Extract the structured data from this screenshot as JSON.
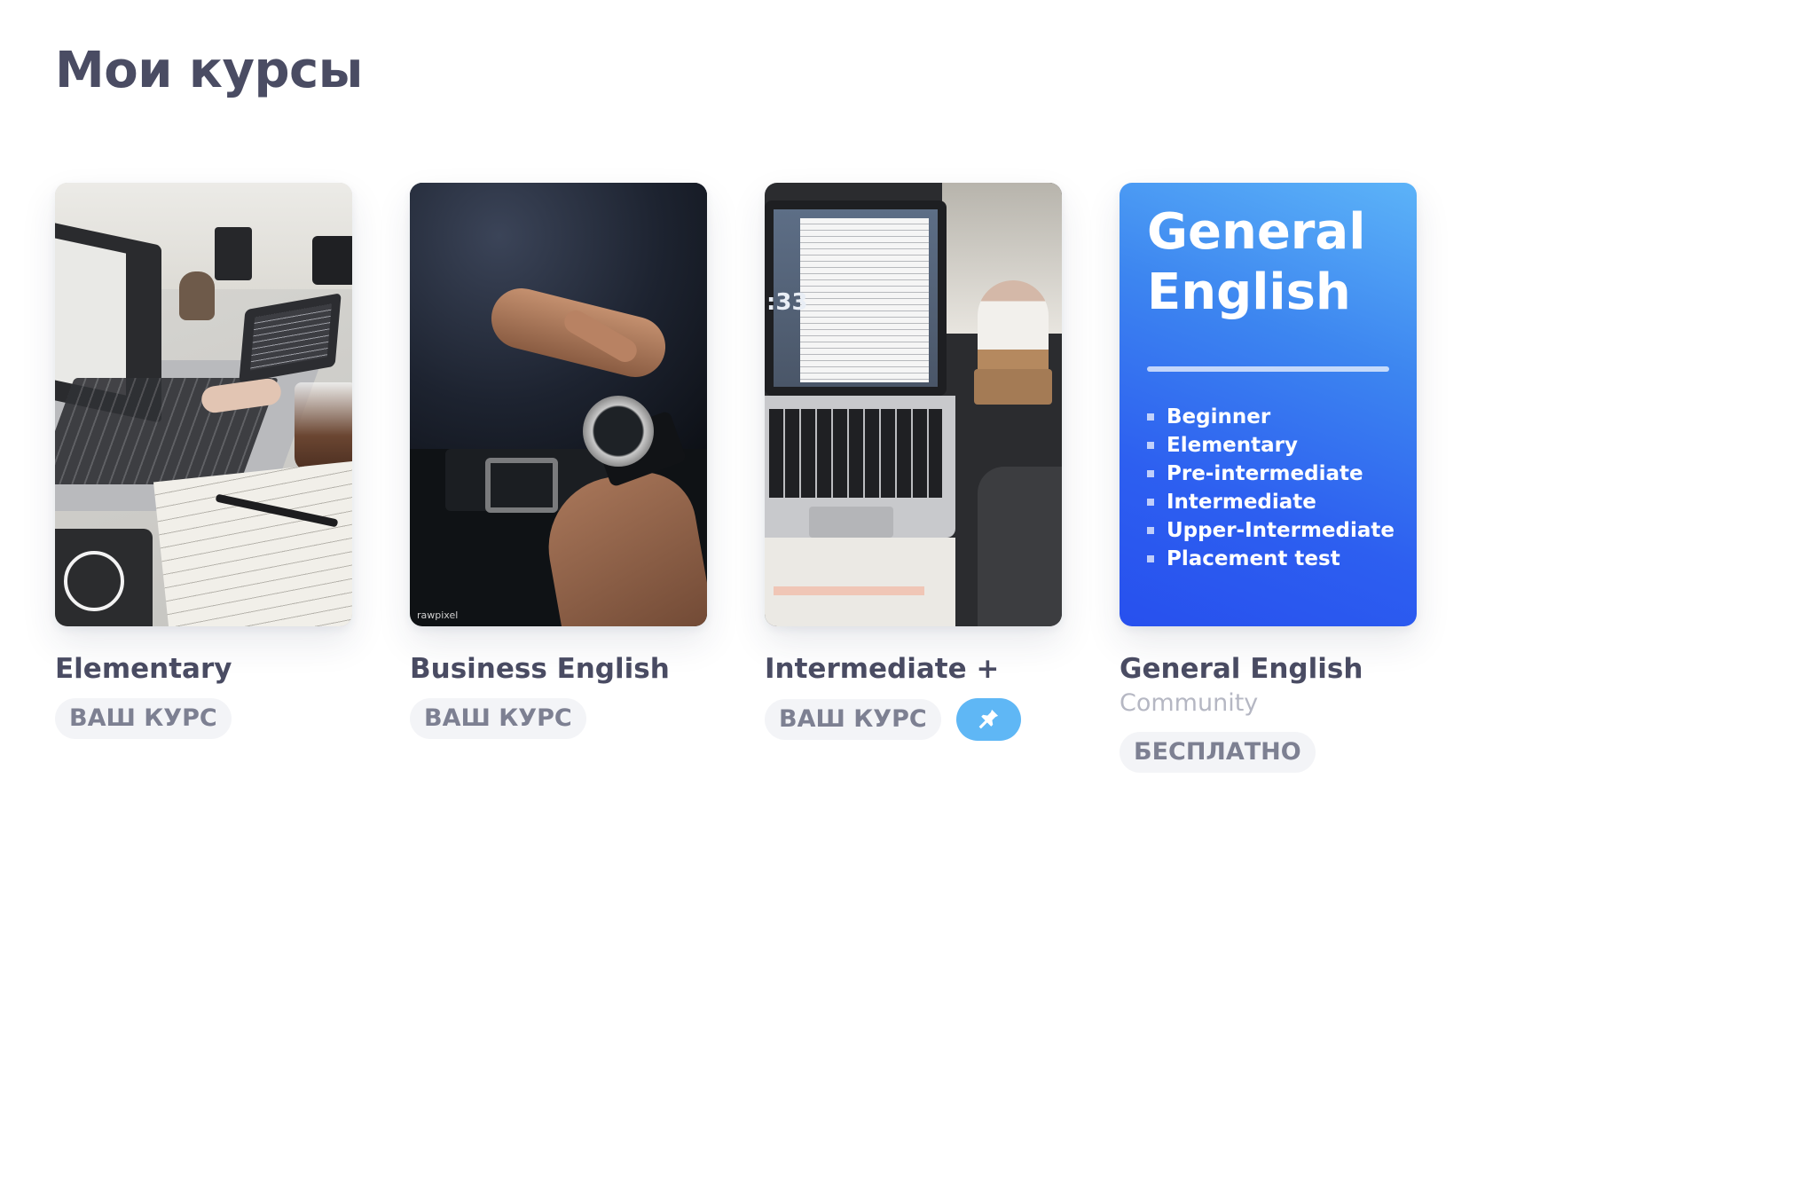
{
  "page": {
    "title": "Мои курсы"
  },
  "courses": [
    {
      "name": "Elementary",
      "badge": "ВАШ КУРС",
      "cover": "desk-laptop-photo"
    },
    {
      "name": "Business English",
      "badge": "ВАШ КУРС",
      "cover": "watch-photo",
      "watermark": "rawpixel"
    },
    {
      "name": "Intermediate +",
      "badge": "ВАШ КУРС",
      "cover": "laptop-coffee-photo",
      "pin_icon": "pin-icon",
      "pin_color": "#5fb7f5"
    },
    {
      "name": "General English",
      "subtitle": "Community",
      "badge": "БЕСПЛАТНО",
      "cover": {
        "title": "General English",
        "levels": [
          "Beginner",
          "Elementary",
          "Pre-intermediate",
          "Intermediate",
          "Upper-Intermediate",
          "Placement test"
        ],
        "gradient": [
          "#5cb3f8",
          "#2750ee"
        ]
      }
    }
  ],
  "colors": {
    "text": "#4a4c63",
    "muted": "#b5b7c3",
    "badge_bg": "#f3f4f7",
    "badge_text": "#7d8092"
  }
}
